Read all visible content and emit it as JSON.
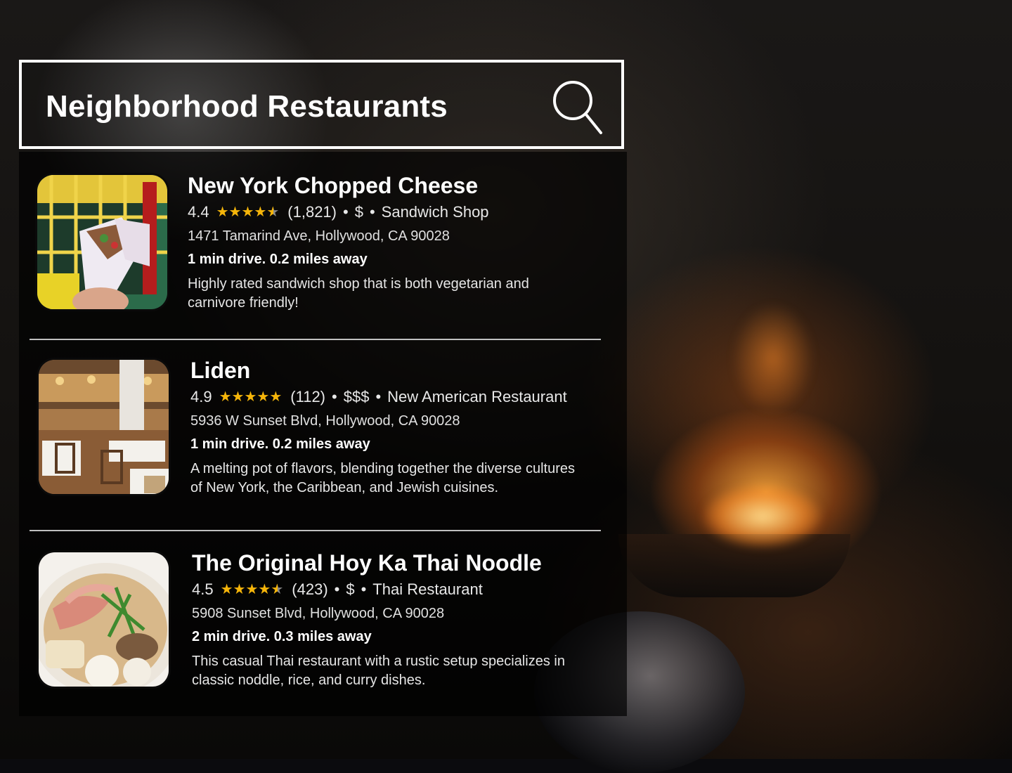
{
  "header": {
    "title": "Neighborhood Restaurants",
    "search_icon": "search-icon"
  },
  "colors": {
    "star": "#f5b50a",
    "text": "#ffffff",
    "panel": "rgba(0,0,0,0.68)"
  },
  "restaurants": [
    {
      "name": "New York Chopped Cheese",
      "rating": "4.4",
      "rating_value": 4.4,
      "reviews": "(1,821)",
      "price": "$",
      "category": "Sandwich Shop",
      "address": "1471 Tamarind Ave, Hollywood, CA 90028",
      "distance": "1 min drive. 0.2 miles away",
      "description": "Highly rated sandwich shop that is both vegetarian and carnivore friendly!"
    },
    {
      "name": "Liden",
      "rating": "4.9",
      "rating_value": 4.9,
      "reviews": "(112)",
      "price": "$$$",
      "category": "New American Restaurant",
      "address": "5936 W Sunset Blvd, Hollywood, CA 90028",
      "distance": "1 min drive. 0.2 miles away",
      "description": "A melting pot of flavors, blending together the diverse cultures of New York, the Caribbean, and Jewish cuisines."
    },
    {
      "name": "The Original Hoy Ka Thai Noodle",
      "rating": "4.5",
      "rating_value": 4.5,
      "reviews": "(423)",
      "price": "$",
      "category": "Thai Restaurant",
      "address": "5908 Sunset Blvd, Hollywood, CA 90028",
      "distance": "2 min drive. 0.3 miles away",
      "description": "This casual Thai restaurant with a rustic setup specializes in classic noddle, rice, and curry dishes."
    }
  ]
}
